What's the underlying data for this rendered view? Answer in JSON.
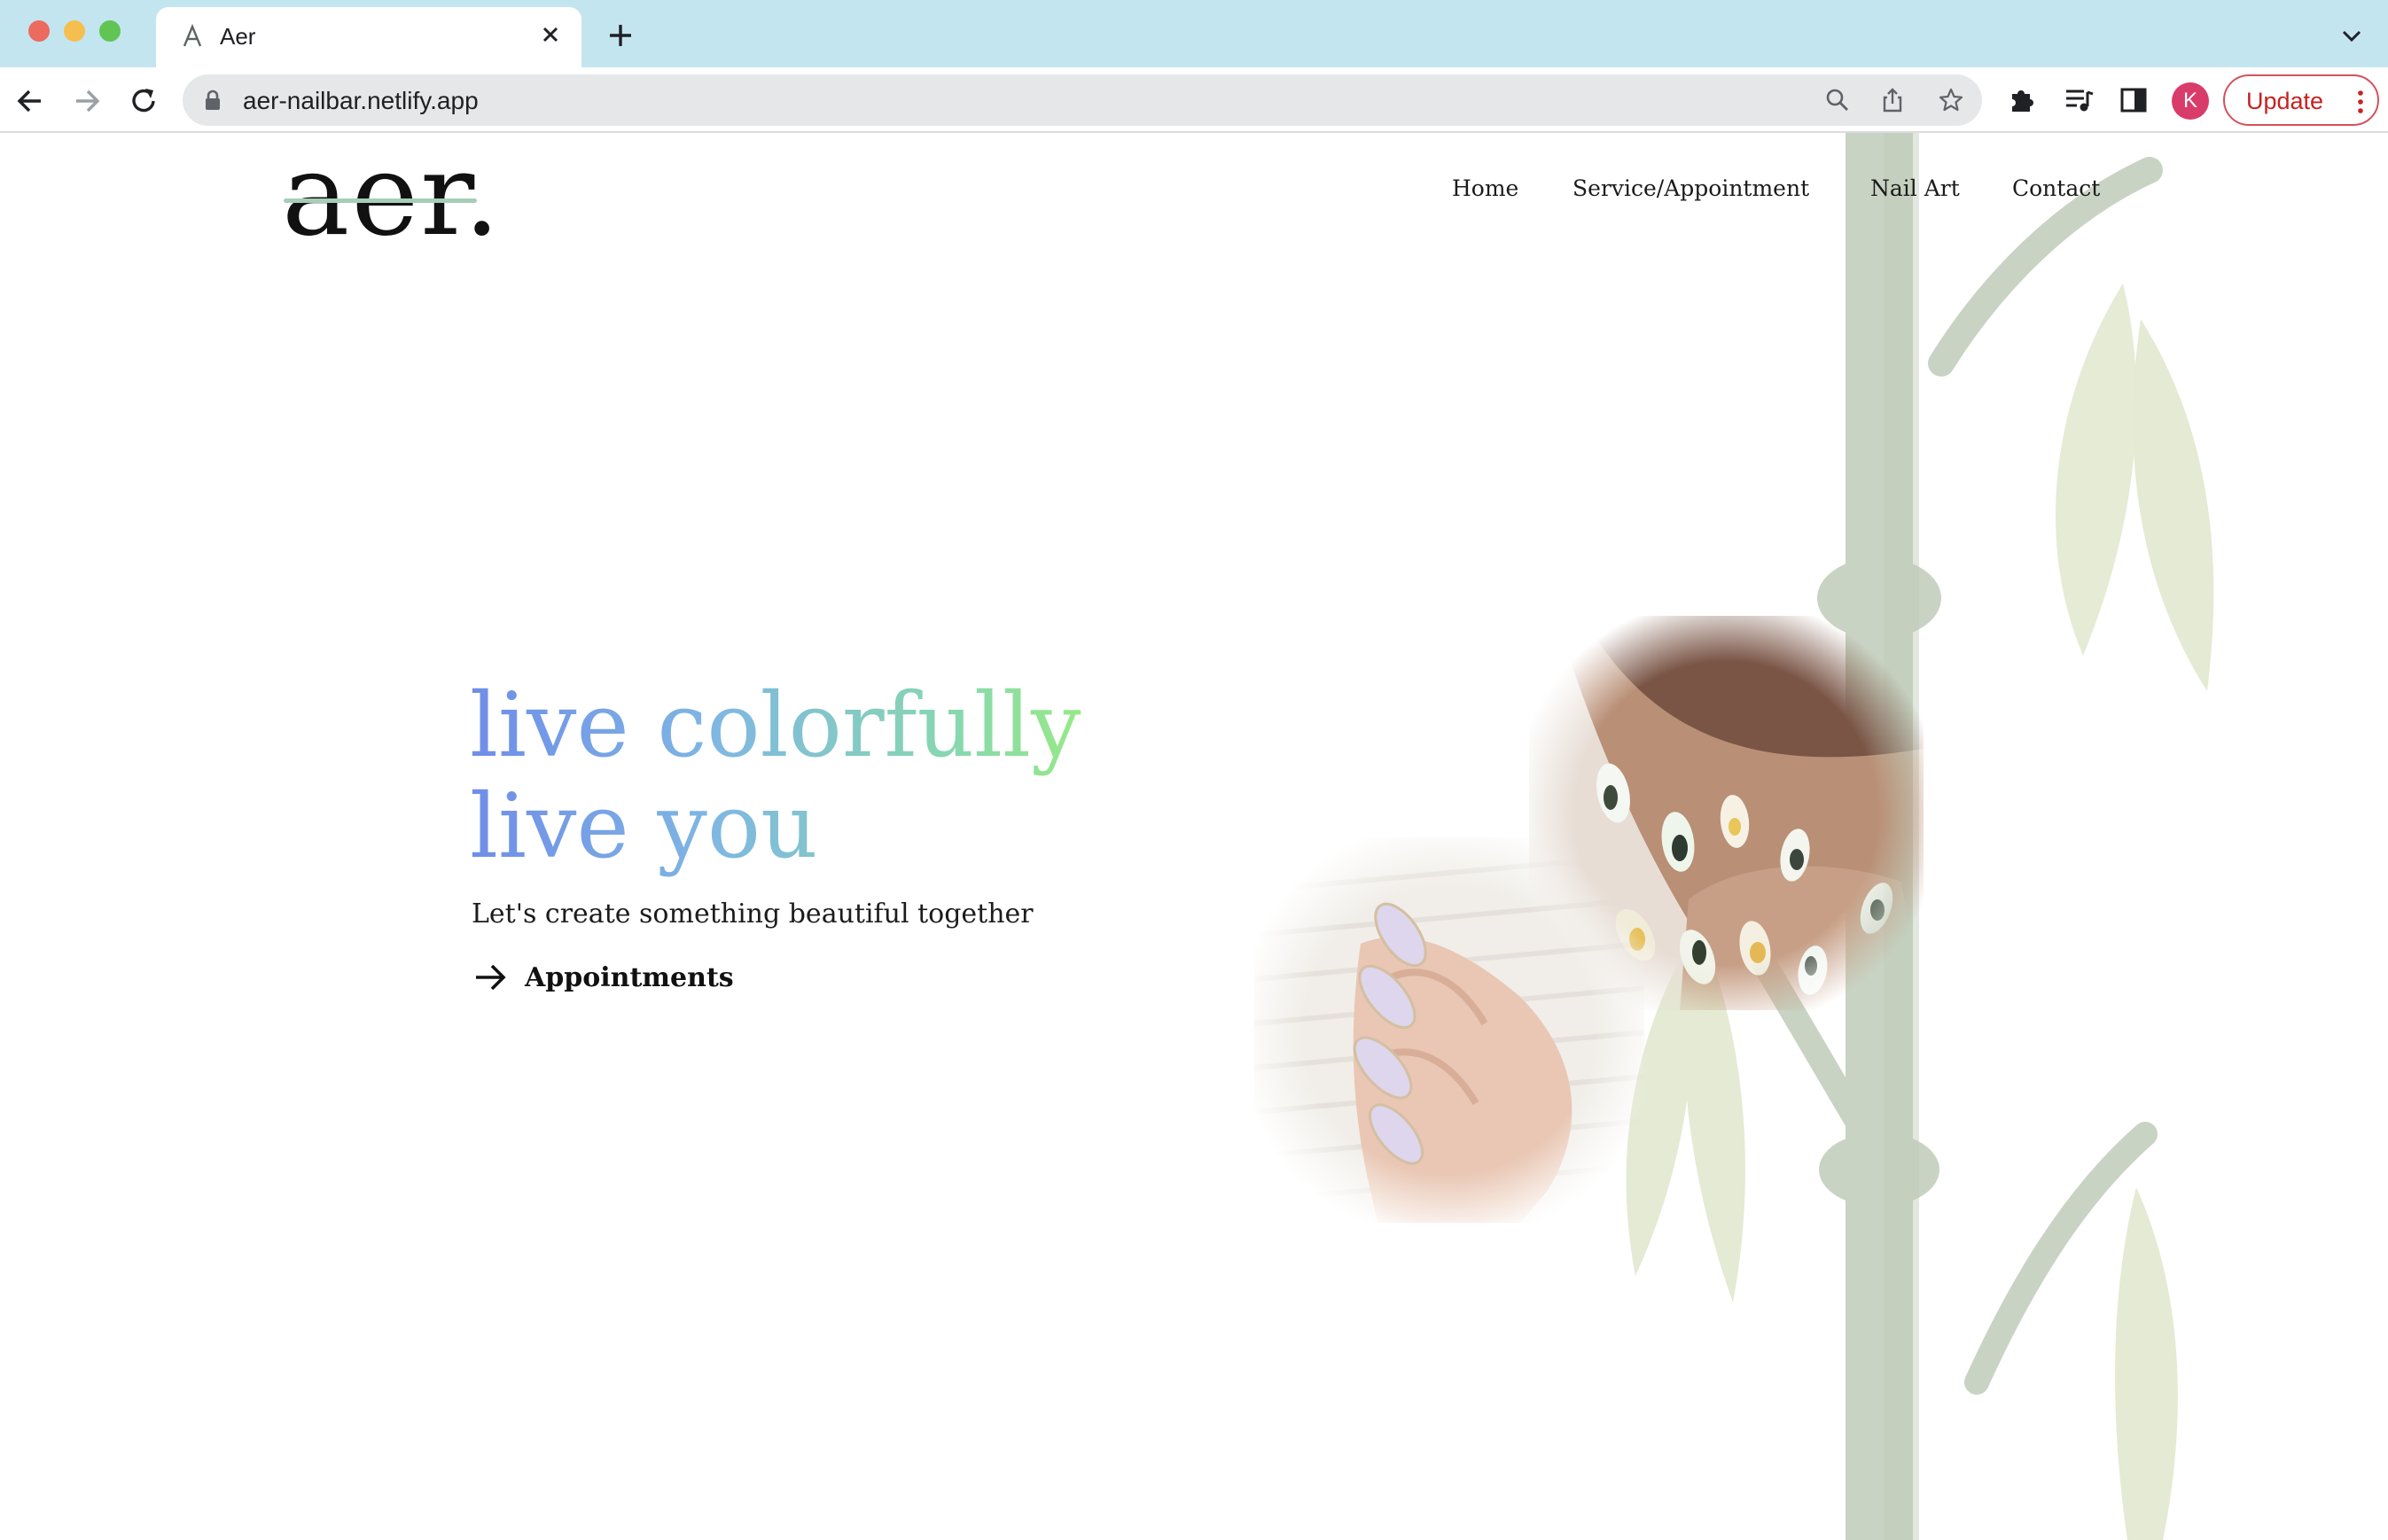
{
  "browser": {
    "tab_title": "Aer",
    "url": "aer-nailbar.netlify.app",
    "profile_initial": "K",
    "update_label": "Update"
  },
  "site": {
    "logo": "aer.",
    "nav": [
      "Home",
      "Service/Appointment",
      "Nail Art",
      "Contact"
    ],
    "hero": {
      "headline_line1": "live colorfully",
      "headline_line2": "live you",
      "subtitle": "Let's create something beautiful together",
      "cta_label": "Appointments"
    }
  },
  "colors": {
    "tabbar_bg": "#c3e5f0",
    "headline_gradient": [
      "#6f8de9",
      "#7fb7e2",
      "#88d8ae",
      "#96ea86"
    ],
    "bamboo_stalk": "#c9d3c3",
    "bamboo_leaf": "#e4ead3",
    "update_accent": "#c5221f",
    "avatar": "#d93c6a"
  }
}
